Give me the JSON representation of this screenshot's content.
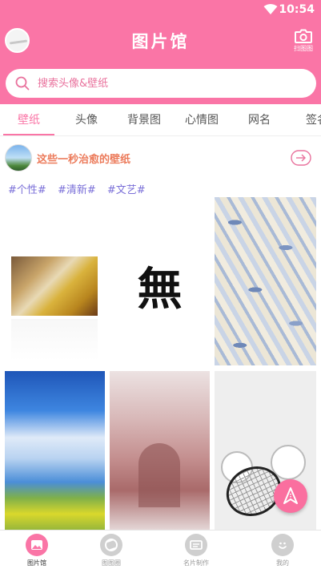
{
  "status_bar": {
    "time": "10:54"
  },
  "header": {
    "title": "图片馆",
    "camera_label": "扫图图",
    "accent_color": "#fa75a6"
  },
  "search": {
    "placeholder": "搜索头像&壁纸"
  },
  "tabs": [
    {
      "label": "壁纸",
      "active": true
    },
    {
      "label": "头像"
    },
    {
      "label": "背景图"
    },
    {
      "label": "心情图"
    },
    {
      "label": "网名"
    },
    {
      "label": "签名"
    }
  ],
  "banner": {
    "text": "这些一秒治愈的壁纸"
  },
  "tags": [
    "#个性#",
    "#清新#",
    "#文艺#"
  ],
  "grid": {
    "glyph_text": "無"
  },
  "bottom_nav": [
    {
      "label": "图片馆",
      "icon": "image-icon",
      "active": true
    },
    {
      "label": "图图圈",
      "icon": "aperture-icon"
    },
    {
      "label": "名片制作",
      "icon": "card-icon"
    },
    {
      "label": "我的",
      "icon": "smile-icon"
    }
  ]
}
